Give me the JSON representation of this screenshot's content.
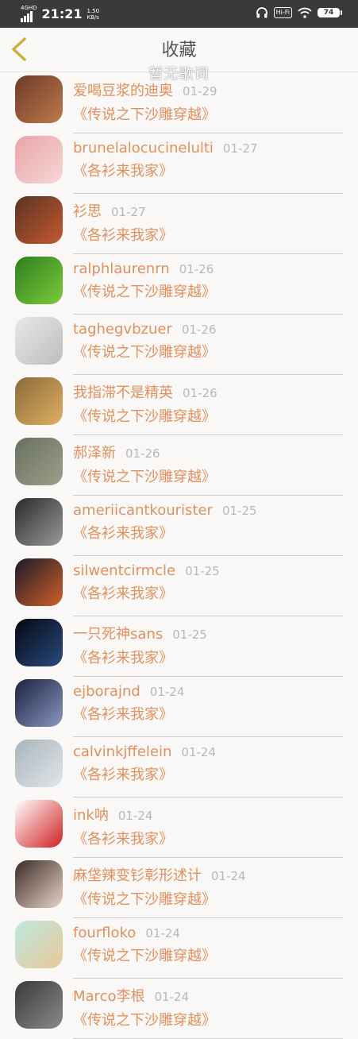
{
  "status_bar": {
    "network": "4GHD",
    "time": "21:21",
    "speed_value": "1.50",
    "speed_unit": "KB/s",
    "hifi": "Hi-Fi",
    "battery": "74"
  },
  "header": {
    "title": "收藏",
    "subtitle": "暂无歌词"
  },
  "favorites": [
    {
      "name": "爱喝豆浆的迪奥",
      "date": "01-29",
      "book": "《传说之下沙雕穿越》",
      "avatar": "anime-character-avatar",
      "colors": [
        "#6b3a2a",
        "#c07a4a"
      ]
    },
    {
      "name": "brunelalocucinelulti",
      "date": "01-27",
      "book": "《各衫来我家》",
      "avatar": "pink-sticker-avatar",
      "colors": [
        "#e9a3a8",
        "#f6d8d6"
      ]
    },
    {
      "name": "衫思",
      "date": "01-27",
      "book": "《各衫来我家》",
      "avatar": "cartoon-characters-avatar",
      "colors": [
        "#5a3324",
        "#c45a2e"
      ]
    },
    {
      "name": "ralphlaurenrn",
      "date": "01-26",
      "book": "《传说之下沙雕穿越》",
      "avatar": "green-leaf-avatar",
      "colors": [
        "#2e7d1f",
        "#7ccc3a"
      ]
    },
    {
      "name": "taghegvbzuer",
      "date": "01-26",
      "book": "《传说之下沙雕穿越》",
      "avatar": "girl-portrait-avatar",
      "colors": [
        "#e8e8e8",
        "#bdbdbd"
      ]
    },
    {
      "name": "我指滞不是精英",
      "date": "01-26",
      "book": "《传说之下沙雕穿越》",
      "avatar": "sunset-road-avatar",
      "colors": [
        "#8a6a3a",
        "#e0b060"
      ]
    },
    {
      "name": "郝泽新",
      "date": "01-26",
      "book": "《传说之下沙雕穿越》",
      "avatar": "man-outdoor-avatar",
      "colors": [
        "#6a7060",
        "#9aa088"
      ]
    },
    {
      "name": "ameriicantkourister",
      "date": "01-25",
      "book": "《各衫来我家》",
      "avatar": "man-grayscale-avatar",
      "colors": [
        "#2a2a2a",
        "#9a9a9a"
      ]
    },
    {
      "name": "silwentcirmcle",
      "date": "01-25",
      "book": "《各衫来我家》",
      "avatar": "car-sunset-avatar",
      "colors": [
        "#1a1a2a",
        "#d0602a"
      ]
    },
    {
      "name": "一只死神sans",
      "date": "01-25",
      "book": "《各衫来我家》",
      "avatar": "dark-blue-avatar",
      "colors": [
        "#05070f",
        "#2a4a80"
      ]
    },
    {
      "name": "ejborajnd",
      "date": "01-24",
      "book": "《各衫来我家》",
      "avatar": "night-city-avatar",
      "colors": [
        "#1a2040",
        "#8a98c0"
      ]
    },
    {
      "name": "calvinkjffelein",
      "date": "01-24",
      "book": "《各衫来我家》",
      "avatar": "dandelion-avatar",
      "colors": [
        "#aab4bc",
        "#e0e6ea"
      ]
    },
    {
      "name": "ink呐",
      "date": "01-24",
      "book": "《各衫来我家》",
      "avatar": "panda-drawing-avatar",
      "colors": [
        "#ffffff",
        "#d02020"
      ]
    },
    {
      "name": "麻垡辣变钐彰形述计",
      "date": "01-24",
      "book": "《传说之下沙雕穿越》",
      "avatar": "woman-portrait-avatar",
      "colors": [
        "#3a2a26",
        "#e8d4c8"
      ]
    },
    {
      "name": "fourfloko",
      "date": "01-24",
      "book": "《传说之下沙雕穿越》",
      "avatar": "puppy-cartoon-avatar",
      "colors": [
        "#bfe8e0",
        "#e8c898"
      ]
    },
    {
      "name": "Marco李根",
      "date": "01-24",
      "book": "《传说之下沙雕穿越》",
      "avatar": "person-dark-avatar",
      "colors": [
        "#3a3a3a",
        "#8a8a8a"
      ]
    }
  ]
}
